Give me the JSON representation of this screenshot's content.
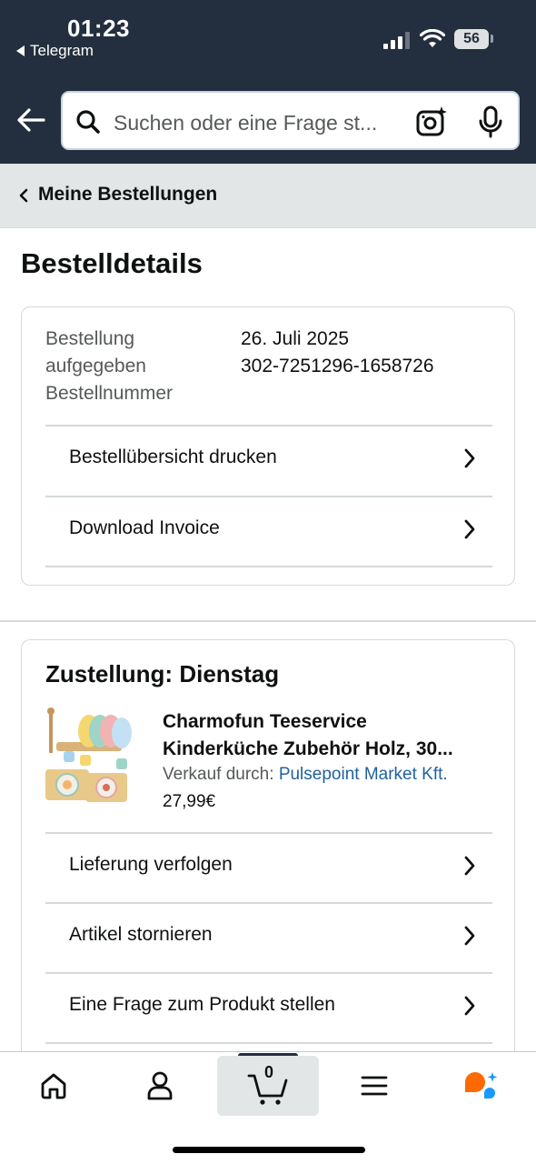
{
  "status_bar": {
    "time": "01:23",
    "back_app": "Telegram",
    "battery": "56"
  },
  "header": {
    "search_placeholder": "Suchen oder eine Frage st..."
  },
  "breadcrumb": {
    "label": "Meine Bestellungen"
  },
  "page": {
    "title": "Bestelldetails"
  },
  "order_info": {
    "placed_label_line1": "Bestellung",
    "placed_label_line2": "aufgegeben",
    "number_label": "Bestellnummer",
    "placed_value": "26. Juli 2025",
    "number_value": "302-7251296-1658726"
  },
  "order_actions": [
    {
      "label": "Bestellübersicht drucken"
    },
    {
      "label": "Download Invoice"
    }
  ],
  "shipment": {
    "title": "Zustellung: Dienstag",
    "product_name_line1": "Charmofun Teeservice",
    "product_name_line2": "Kinderküche Zubehör Holz, 30...",
    "sold_by_label": "Verkauf durch:",
    "seller": "Pulsepoint Market Kft.",
    "price": "27,99€",
    "actions": [
      {
        "label": "Lieferung verfolgen"
      },
      {
        "label": "Artikel stornieren"
      },
      {
        "label": "Eine Frage zum Produkt stellen"
      }
    ]
  },
  "tabbar": {
    "cart_count": "0",
    "tabs": [
      "home-icon",
      "account-icon",
      "cart-icon",
      "menu-icon",
      "rufus-assistant-icon"
    ]
  },
  "colors": {
    "header_bg": "#232f3e",
    "link": "#2162a1",
    "assistant_orange": "#ff6a00",
    "assistant_blue": "#1a98ff"
  }
}
